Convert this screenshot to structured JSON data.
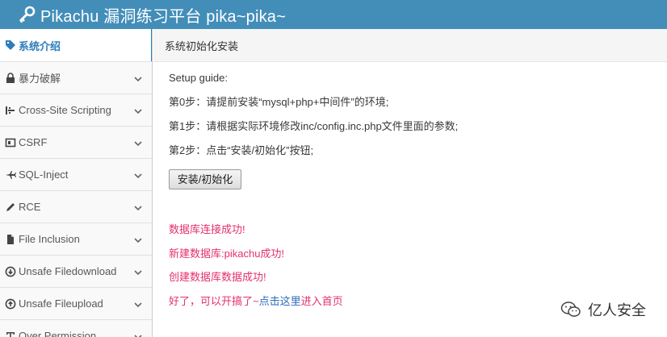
{
  "header": {
    "title": "Pikachu 漏洞练习平台 pika~pika~",
    "logo_icon": "key-icon"
  },
  "sidebar": {
    "items": [
      {
        "label": "系统介绍",
        "icon": "tag-icon",
        "active": true
      },
      {
        "label": "暴力破解",
        "icon": "lock-icon"
      },
      {
        "label": "Cross-Site Scripting",
        "icon": "list-icon"
      },
      {
        "label": "CSRF",
        "icon": "caption-icon"
      },
      {
        "label": "SQL-Inject",
        "icon": "plane-icon"
      },
      {
        "label": "RCE",
        "icon": "pencil-icon"
      },
      {
        "label": "File Inclusion",
        "icon": "file-icon"
      },
      {
        "label": "Unsafe Filedownload",
        "icon": "download-icon"
      },
      {
        "label": "Unsafe Fileupload",
        "icon": "upload-icon"
      },
      {
        "label": "Over Permission",
        "icon": "text-width-icon"
      }
    ]
  },
  "breadcrumb": "系统初始化安装",
  "guide": {
    "heading": "Setup guide:",
    "step0": "第0步：请提前安装“mysql+php+中间件”的环境;",
    "step1": "第1步：请根据实际环境修改inc/config.inc.php文件里面的参数;",
    "step2": "第2步：点击“安装/初始化”按钮;",
    "button": "安装/初始化"
  },
  "messages": {
    "db_connect": "数据库连接成功!",
    "db_create": "新建数据库:pikachu成功!",
    "data_create": "创建数据库数据成功!",
    "ready_prefix": "好了，可以开搞了~",
    "ready_link": "点击这里",
    "ready_suffix": "进入首页"
  },
  "watermark": {
    "text": "亿人安全",
    "icon": "wechat-icon"
  },
  "colors": {
    "header_bg": "#438eb9",
    "active_blue": "#2b7dbc",
    "success_pink": "#e4306f",
    "link_blue": "#2a6bbd"
  }
}
